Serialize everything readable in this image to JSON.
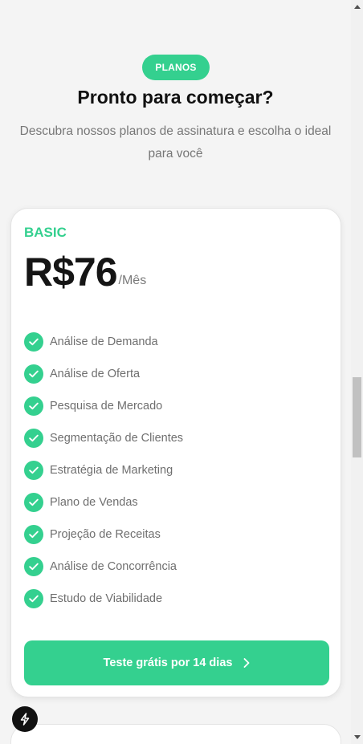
{
  "section": {
    "badge": "PLANOS",
    "title": "Pronto para começar?",
    "subtitle": "Descubra nossos planos de assinatura e escolha o ideal para você"
  },
  "plan": {
    "name": "BASIC",
    "price": "R$76",
    "period": "/Mês",
    "features": [
      "Análise de Demanda",
      "Análise de Oferta",
      "Pesquisa de Mercado",
      "Segmentação de Clientes",
      "Estratégia de Marketing",
      "Plano de Vendas",
      "Projeção de Receitas",
      "Análise de Concorrência",
      "Estudo de Viabilidade"
    ],
    "cta_label": "Teste grátis por 14 dias"
  },
  "icons": {
    "feature": "check-circle-icon",
    "cta": "chevron-right-icon",
    "fab": "lightning-bolt-icon"
  },
  "colors": {
    "accent": "#34d08f",
    "background": "#f4f4f4",
    "card": "#ffffff",
    "title": "#111111",
    "muted": "#777777"
  }
}
